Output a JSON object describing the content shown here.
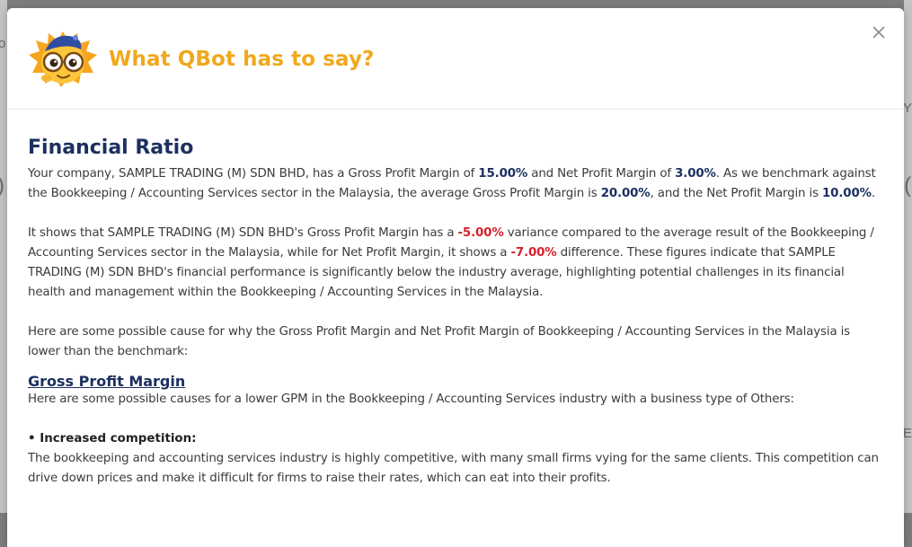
{
  "modal": {
    "title": "What QBot has to say?",
    "close_label": "×"
  },
  "ratio": {
    "heading": "Financial Ratio",
    "p1": {
      "t1": "Your company, SAMPLE TRADING (M) SDN BHD, has a Gross Profit Margin of ",
      "gpm": "15.00%",
      "t2": " and Net Profit Margin of ",
      "npm": "3.00%",
      "t3": ". As we benchmark against the Bookkeeping / Accounting Services sector in the Malaysia, the average Gross Profit Margin is ",
      "avg_gpm": "20.00%",
      "t4": ", and the Net Profit Margin is ",
      "avg_npm": "10.00%",
      "t5": "."
    },
    "p2": {
      "t1": "It shows that SAMPLE TRADING (M) SDN BHD's Gross Profit Margin has a ",
      "gpm_var": "-5.00%",
      "t2": " variance compared to the average result of the Bookkeeping / Accounting Services sector in the Malaysia, while for Net Profit Margin, it shows a ",
      "npm_var": "-7.00%",
      "t3": " difference. These figures indicate that SAMPLE TRADING (M) SDN BHD's financial performance is significantly below the industry average, highlighting potential challenges in its financial health and management within the Bookkeeping / Accounting Services in the Malaysia."
    },
    "p3": "Here are some possible cause for why the Gross Profit Margin and Net Profit Margin of Bookkeeping / Accounting Services in the Malaysia is lower than the benchmark:"
  },
  "gpm_section": {
    "heading": "Gross Profit Margin",
    "intro": "Here are some possible causes for a lower GPM in the Bookkeeping / Accounting Services industry with a business type of Others:",
    "bullet_title": "• Increased competition:",
    "bullet_text": "The bookkeeping and accounting services industry is highly competitive, with many small firms vying for the same clients. This competition can drive down prices and make it difficult for firms to raise their rates, which can eat into their profits."
  },
  "background": {
    "frag_left_1": "o",
    "frag_left_2": ")",
    "frag_right_1": "Y",
    "frag_right_2": "(",
    "frag_right_3": "E"
  },
  "colors": {
    "title": "#f0a81c",
    "heading": "#1c3060",
    "negative": "#d6202c"
  },
  "icons": [
    "qbot-mascot-icon",
    "close-icon"
  ]
}
